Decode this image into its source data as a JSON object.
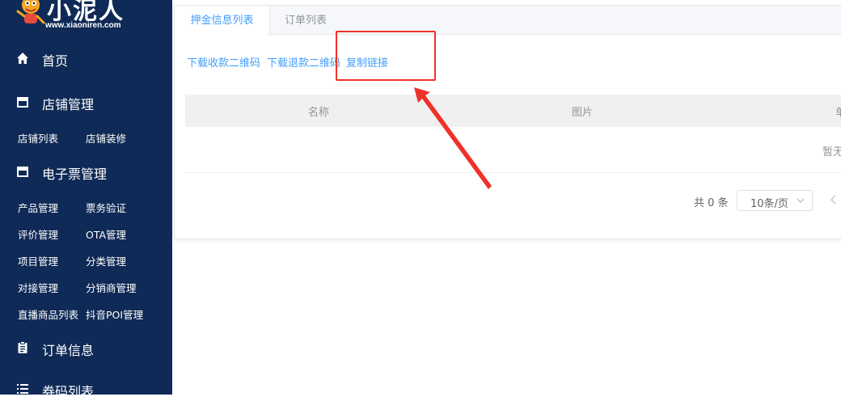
{
  "brand": {
    "name": "小泥人",
    "url": "www.xiaoniren.com"
  },
  "sidebar": {
    "groups": [
      {
        "label": "首页",
        "icon": "home-icon"
      },
      {
        "label": "店铺管理",
        "icon": "store-icon"
      },
      {
        "label": "电子票管理",
        "icon": "store-icon"
      },
      {
        "label": "订单信息",
        "icon": "clipboard-icon"
      },
      {
        "label": "券码列表",
        "icon": "list-icon"
      }
    ],
    "store_items": [
      "店铺列表",
      "店铺装修"
    ],
    "ticket_items": [
      "产品管理",
      "票务验证",
      "评价管理",
      "OTA管理",
      "项目管理",
      "分类管理",
      "对接管理",
      "分销商管理",
      "直播商品列表",
      "抖音POI管理"
    ]
  },
  "tabs": [
    {
      "label": "押金信息列表",
      "active": true
    },
    {
      "label": "订单列表",
      "active": false
    }
  ],
  "actions": {
    "download_collect_qr": "下载收款二维码",
    "download_refund_qr": "下载退款二维码",
    "copy_link": "复制链接"
  },
  "table": {
    "columns": [
      "名称",
      "图片",
      "单"
    ],
    "empty_text": "暂无"
  },
  "pagination": {
    "total_text": "共 0 条",
    "page_size": "10条/页"
  },
  "colors": {
    "sidebar_bg": "#0f2a56",
    "accent": "#409eff",
    "annotation": "#f0312a"
  }
}
